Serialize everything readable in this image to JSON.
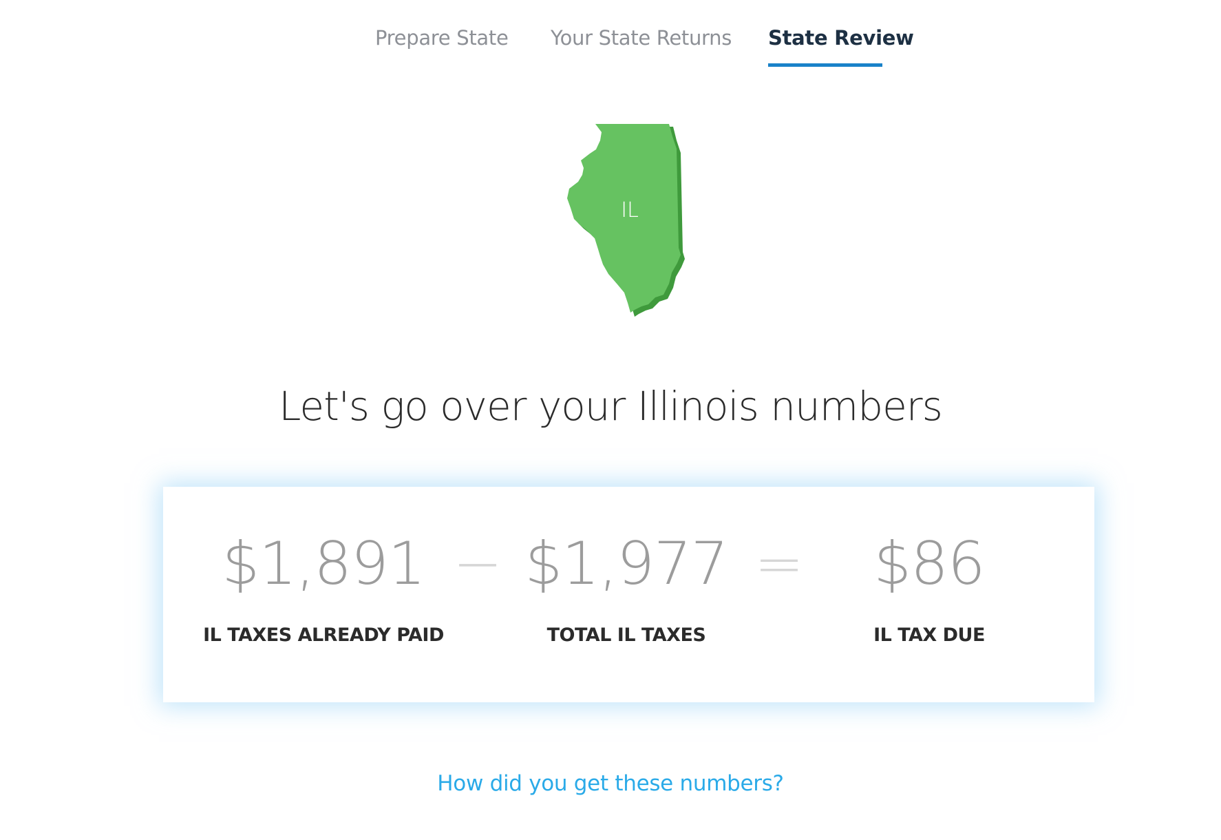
{
  "tabs": [
    {
      "label": "Prepare State",
      "active": false
    },
    {
      "label": "Your State Returns",
      "active": false
    },
    {
      "label": "State Review",
      "active": true
    }
  ],
  "state": {
    "abbreviation": "IL",
    "color": "#66c261",
    "shadow_color": "#3f9a3c"
  },
  "heading": "Let's go over your Illinois numbers",
  "summary": {
    "already_paid": {
      "amount": "$1,891",
      "label": "IL TAXES ALREADY PAID"
    },
    "minus_sign": "−",
    "total": {
      "amount": "$1,977",
      "label": "TOTAL IL TAXES"
    },
    "equals_sign": "=",
    "due": {
      "amount": "$86",
      "label": "IL TAX DUE"
    }
  },
  "help_link": "How did you get these numbers?",
  "colors": {
    "accent": "#1a82c9",
    "link": "#2aaae8",
    "amount": "#9c9c9c"
  }
}
